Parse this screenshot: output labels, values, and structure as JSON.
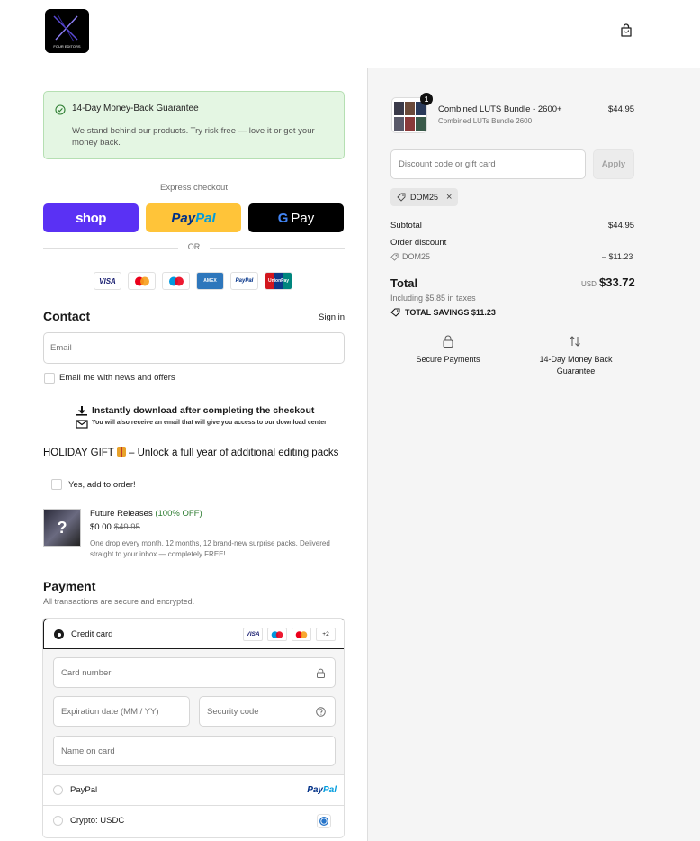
{
  "header": {
    "logo_text": "FOUR EDITORS",
    "cart_icon": "shopping-bag-icon"
  },
  "guarantee": {
    "title": "14-Day Money-Back Guarantee",
    "description": "We stand behind our products. Try risk-free — love it or get your money back."
  },
  "express": {
    "label": "Express checkout",
    "shop_label": "shop",
    "paypal_part1": "Pay",
    "paypal_part2": "Pal",
    "gpay_g": "G",
    "gpay_label": "Pay",
    "or_label": "OR"
  },
  "accepted_cards": [
    "VISA",
    "MC",
    "Maestro",
    "AMEX",
    "PayPal",
    "UnionPay"
  ],
  "contact": {
    "heading": "Contact",
    "signin": "Sign in",
    "email_placeholder": "Email",
    "news_label": "Email me with news and offers"
  },
  "download_notice": {
    "title": "Instantly download after completing the checkout",
    "subtitle": "You will also receive an email that will give you access to our download center"
  },
  "holiday": {
    "prefix": "HOLIDAY GIFT",
    "suffix": "– Unlock a full year of additional editing packs",
    "add_label": "Yes, add to order!"
  },
  "future_releases": {
    "image_glyph": "?",
    "title": "Future Releases",
    "discount": "(100% OFF)",
    "price": "$0.00",
    "old_price": "$49.95",
    "description": "One drop every month. 12 months, 12 brand-new surprise packs. Delivered straight to your inbox — completely FREE!"
  },
  "payment": {
    "heading": "Payment",
    "subheading": "All transactions are secure and encrypted.",
    "credit_card_label": "Credit card",
    "mini_cards": [
      "VISA",
      "",
      "",
      "+2"
    ],
    "card_number_placeholder": "Card number",
    "expiration_placeholder": "Expiration date (MM / YY)",
    "security_placeholder": "Security code",
    "name_placeholder": "Name on card",
    "paypal_label": "PayPal",
    "paypal_logo_1": "Pay",
    "paypal_logo_2": "Pal",
    "crypto_label": "Crypto: USDC"
  },
  "summary": {
    "quantity": "1",
    "product_name": "Combined LUTS Bundle - 2600+",
    "product_variant": "Combined LUTs Bundle 2600",
    "product_price": "$44.95",
    "discount_placeholder": "Discount code or gift card",
    "apply_label": "Apply",
    "code_tag": "DOM25",
    "code_remove": "×",
    "subtotal_label": "Subtotal",
    "subtotal_value": "$44.95",
    "order_discount_label": "Order discount",
    "discount_code": "DOM25",
    "discount_value": "– $11.23",
    "total_label": "Total",
    "currency": "USD",
    "total_value": "$33.72",
    "tax_note": "Including $5.85 in taxes",
    "savings": "TOTAL SAVINGS  $11.23",
    "feature_1": "Secure Payments",
    "feature_2": "14-Day Money Back Guarantee"
  },
  "colors": {
    "shop_purple": "#5a31f4",
    "paypal_yellow": "#ffc439",
    "guarantee_bg": "#e4f6e3",
    "success_green": "#2e7d32"
  }
}
